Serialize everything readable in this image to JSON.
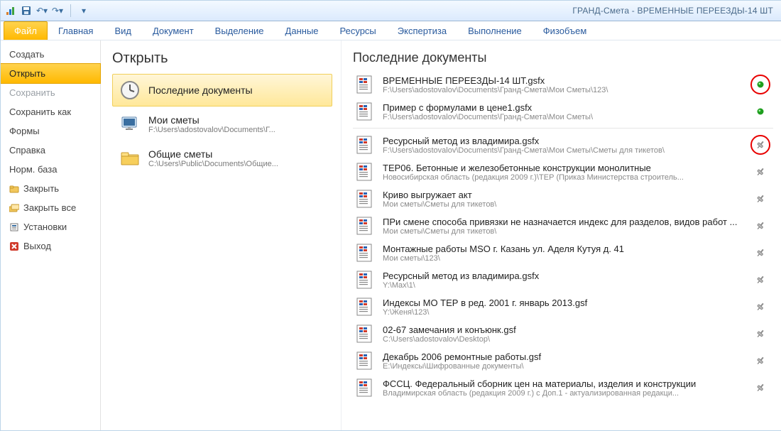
{
  "window": {
    "title": "ГРАНД-Смета - ВРЕМЕННЫЕ ПЕРЕЕЗДЫ-14 ШТ"
  },
  "ribbon": {
    "file": "Файл",
    "tabs": [
      "Главная",
      "Вид",
      "Документ",
      "Выделение",
      "Данные",
      "Ресурсы",
      "Экспертиза",
      "Выполнение",
      "Физобъем"
    ]
  },
  "left": {
    "create": "Создать",
    "open": "Открыть",
    "save": "Сохранить",
    "saveAs": "Сохранить как",
    "forms": "Формы",
    "help": "Справка",
    "normBase": "Норм. база",
    "close": "Закрыть",
    "closeAll": "Закрыть все",
    "setup": "Установки",
    "exit": "Выход"
  },
  "middle": {
    "title": "Открыть",
    "items": [
      {
        "label": "Последние документы",
        "sub": ""
      },
      {
        "label": "Мои сметы",
        "sub": "F:\\Users\\adostovalov\\Documents\\Г..."
      },
      {
        "label": "Общие сметы",
        "sub": "C:\\Users\\Public\\Documents\\Общие..."
      }
    ]
  },
  "right": {
    "title": "Последние документы",
    "pinnedDocs": [
      {
        "title": "ВРЕМЕННЫЕ ПЕРЕЕЗДЫ-14 ШТ.gsfx",
        "path": "F:\\Users\\adostovalov\\Documents\\Гранд-Смета\\Мои Сметы\\123\\",
        "pin": "green",
        "circled": true
      },
      {
        "title": "Пример с формулами в цене1.gsfx",
        "path": "F:\\Users\\adostovalov\\Documents\\Гранд-Смета\\Мои Сметы\\",
        "pin": "green",
        "circled": false
      }
    ],
    "docs": [
      {
        "title": "Ресурсный метод из владимира.gsfx",
        "path": "F:\\Users\\adostovalov\\Documents\\Гранд-Смета\\Мои Сметы\\Сметы для тикетов\\",
        "circled": true
      },
      {
        "title": "ТЕР06. Бетонные и железобетонные конструкции монолитные",
        "path": "Новосибирская область (редакция 2009 г.)\\ТЕР (Приказ Министерства строитель...",
        "circled": false
      },
      {
        "title": "Криво выгружает акт",
        "path": "Мои сметы\\Сметы для тикетов\\",
        "circled": false
      },
      {
        "title": "ПРи смене способа привязки не назначается индекс для разделов, видов работ ...",
        "path": "Мои сметы\\Сметы для тикетов\\",
        "circled": false
      },
      {
        "title": "Монтажные работы MSO г. Казань ул. Аделя Кутуя д. 41",
        "path": "Мои сметы\\123\\",
        "circled": false
      },
      {
        "title": "Ресурсный метод из владимира.gsfx",
        "path": "Y:\\Max\\1\\",
        "circled": false
      },
      {
        "title": "Индексы МО ТЕР в ред. 2001 г. январь 2013.gsf",
        "path": "Y:\\Женя\\123\\",
        "circled": false
      },
      {
        "title": "02-67  замечания и конъюнк.gsf",
        "path": "C:\\Users\\adostovalov\\Desktop\\",
        "circled": false
      },
      {
        "title": "Декабрь 2006 ремонтные работы.gsf",
        "path": "E:\\Индексы\\Шифрованные документы\\",
        "circled": false
      },
      {
        "title": "ФССЦ. Федеральный сборник цен на материалы, изделия и конструкции",
        "path": "Владимирская область (редакция 2009 г.) с Доп.1 - актуализированная редакци...",
        "circled": false
      }
    ]
  }
}
